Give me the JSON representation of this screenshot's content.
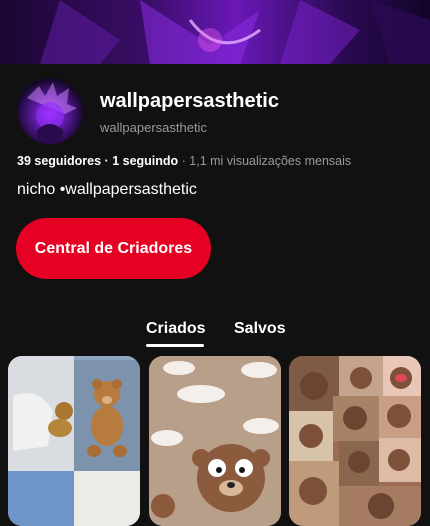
{
  "profile": {
    "display_name": "wallpapersasthetic",
    "username": "wallpapersasthetic",
    "followers": "39 seguidores",
    "following": "1 seguindo",
    "monthly_views": "1,1 mi visualizações mensais",
    "bio": "nicho •wallpapersasthetic"
  },
  "actions": {
    "creator_hub_label": "Central de Criadores"
  },
  "tabs": [
    {
      "label": "Criados",
      "selected": true
    },
    {
      "label": "Salvos",
      "selected": false
    }
  ],
  "colors": {
    "primary_button": "#e60023",
    "background": "#111111",
    "muted_text": "#9a9a9a"
  }
}
